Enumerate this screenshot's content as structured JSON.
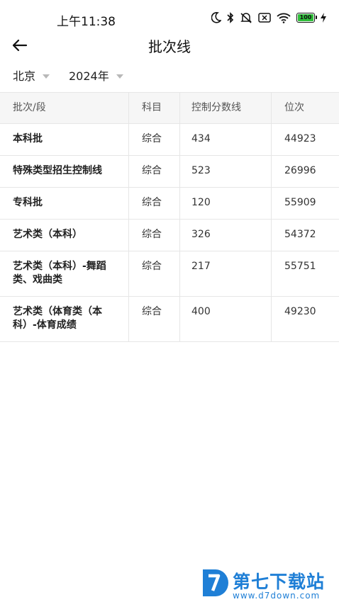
{
  "status_bar": {
    "time": "上午11:38",
    "battery_level": "100",
    "icons": [
      "moon-icon",
      "bluetooth-icon",
      "mute-icon",
      "no-sim-icon",
      "wifi-icon",
      "battery-icon",
      "charging-icon"
    ]
  },
  "header": {
    "title": "批次线",
    "back_icon": "arrow-left-icon"
  },
  "filters": {
    "region": "北京",
    "year": "2024年"
  },
  "table": {
    "columns": [
      "批次/段",
      "科目",
      "控制分数线",
      "位次"
    ],
    "rows": [
      {
        "batch": "本科批",
        "subject": "综合",
        "score": "434",
        "rank": "44923"
      },
      {
        "batch": "特殊类型招生控制线",
        "subject": "综合",
        "score": "523",
        "rank": "26996"
      },
      {
        "batch": "专科批",
        "subject": "综合",
        "score": "120",
        "rank": "55909"
      },
      {
        "batch": "艺术类（本科）",
        "subject": "综合",
        "score": "326",
        "rank": "54372"
      },
      {
        "batch": "艺术类（本科）-舞蹈类、戏曲类",
        "subject": "综合",
        "score": "217",
        "rank": "55751"
      },
      {
        "batch": "艺术类（体育类（本科）-体育成绩",
        "subject": "综合",
        "score": "400",
        "rank": "49230"
      }
    ]
  },
  "watermark": {
    "name": "第七下载站",
    "url": "www.d7down.com"
  },
  "colors": {
    "accent": "#1f7fd6",
    "battery": "#2fbf3a",
    "border": "#e6e6e6",
    "header_bg": "#f6f6f6"
  }
}
